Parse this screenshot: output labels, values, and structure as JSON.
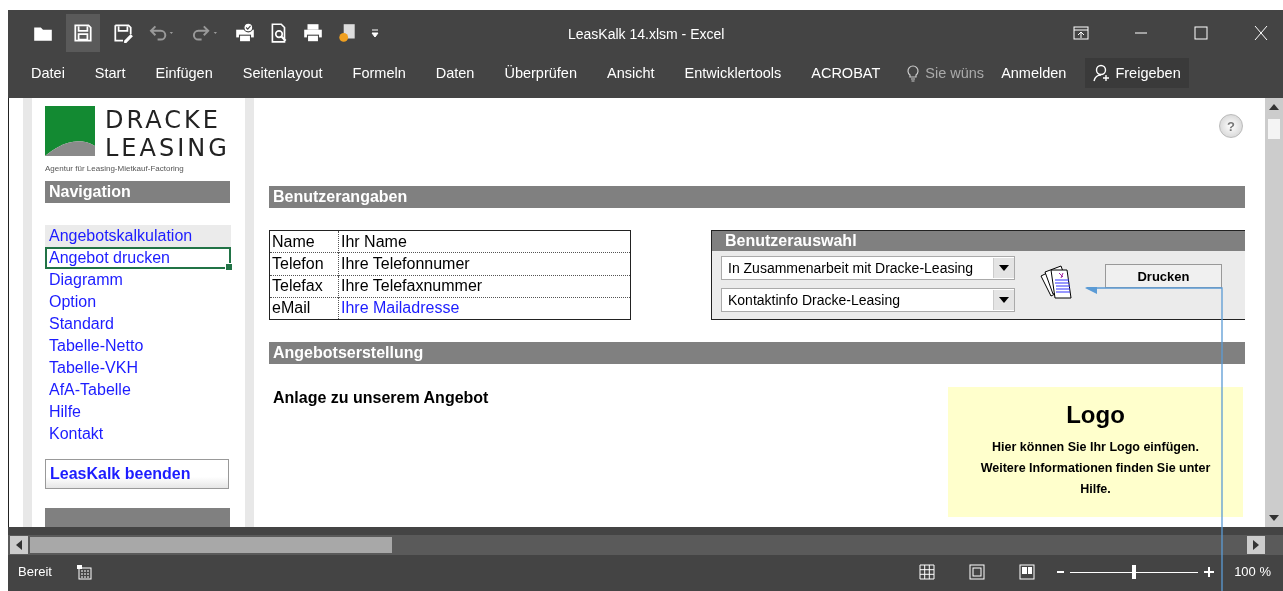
{
  "window": {
    "title": "LeasKalk 14.xlsm - Excel"
  },
  "ribbon": {
    "tabs": [
      {
        "label": "Datei"
      },
      {
        "label": "Start"
      },
      {
        "label": "Einfügen"
      },
      {
        "label": "Seitenlayout"
      },
      {
        "label": "Formeln"
      },
      {
        "label": "Daten"
      },
      {
        "label": "Überprüfen"
      },
      {
        "label": "Ansicht"
      },
      {
        "label": "Entwicklertools"
      },
      {
        "label": "ACROBAT"
      }
    ],
    "tell_me": "Sie wüns",
    "sign_in": "Anmelden",
    "share": "Freigeben"
  },
  "sheet": {
    "logo": {
      "line1": "DRACKE",
      "line2": "LEASING",
      "tagline": "Agentur für Leasing-Mietkauf-Factoring"
    },
    "navigation": {
      "title": "Navigation",
      "items": [
        {
          "label": "Angebotskalkulation",
          "selected": false,
          "shaded": true
        },
        {
          "label": "Angebot drucken",
          "selected": true,
          "shaded": false
        },
        {
          "label": "Diagramm",
          "selected": false,
          "shaded": false
        },
        {
          "label": "Option",
          "selected": false,
          "shaded": false
        },
        {
          "label": "Standard",
          "selected": false,
          "shaded": false
        },
        {
          "label": "Tabelle-Netto",
          "selected": false,
          "shaded": false
        },
        {
          "label": "Tabelle-VKH",
          "selected": false,
          "shaded": false
        },
        {
          "label": "AfA-Tabelle",
          "selected": false,
          "shaded": false
        },
        {
          "label": "Hilfe",
          "selected": false,
          "shaded": false
        },
        {
          "label": "Kontakt",
          "selected": false,
          "shaded": false
        }
      ],
      "exit_button": "LeasKalk beenden"
    },
    "help_button": "?",
    "user_section": {
      "title": "Benutzerangaben",
      "fields": [
        {
          "label": "Name",
          "value": "Ihr Name",
          "kind": "text"
        },
        {
          "label": "Telefon",
          "value": "Ihre Telefonnumer",
          "kind": "text"
        },
        {
          "label": "Telefax",
          "value": "Ihre Telefaxnummer",
          "kind": "text"
        },
        {
          "label": "eMail",
          "value": "Ihre Mailadresse",
          "kind": "link"
        }
      ]
    },
    "user_choice": {
      "title": "Benutzerauswahl",
      "dropdowns": [
        "In Zusammenarbeit mit Dracke-Leasing",
        "Kontaktinfo Dracke-Leasing"
      ],
      "print_button": "Drucken"
    },
    "offer_section": {
      "title": "Angebotserstellung",
      "heading": "Anlage zu unserem Angebot"
    },
    "logo_box": {
      "title": "Logo",
      "text": "Hier können Sie Ihr Logo einfügen. Weitere Informationen finden Sie unter Hilfe."
    }
  },
  "status_bar": {
    "status": "Bereit",
    "zoom": {
      "level": 0.5,
      "reading": "100 %"
    }
  }
}
